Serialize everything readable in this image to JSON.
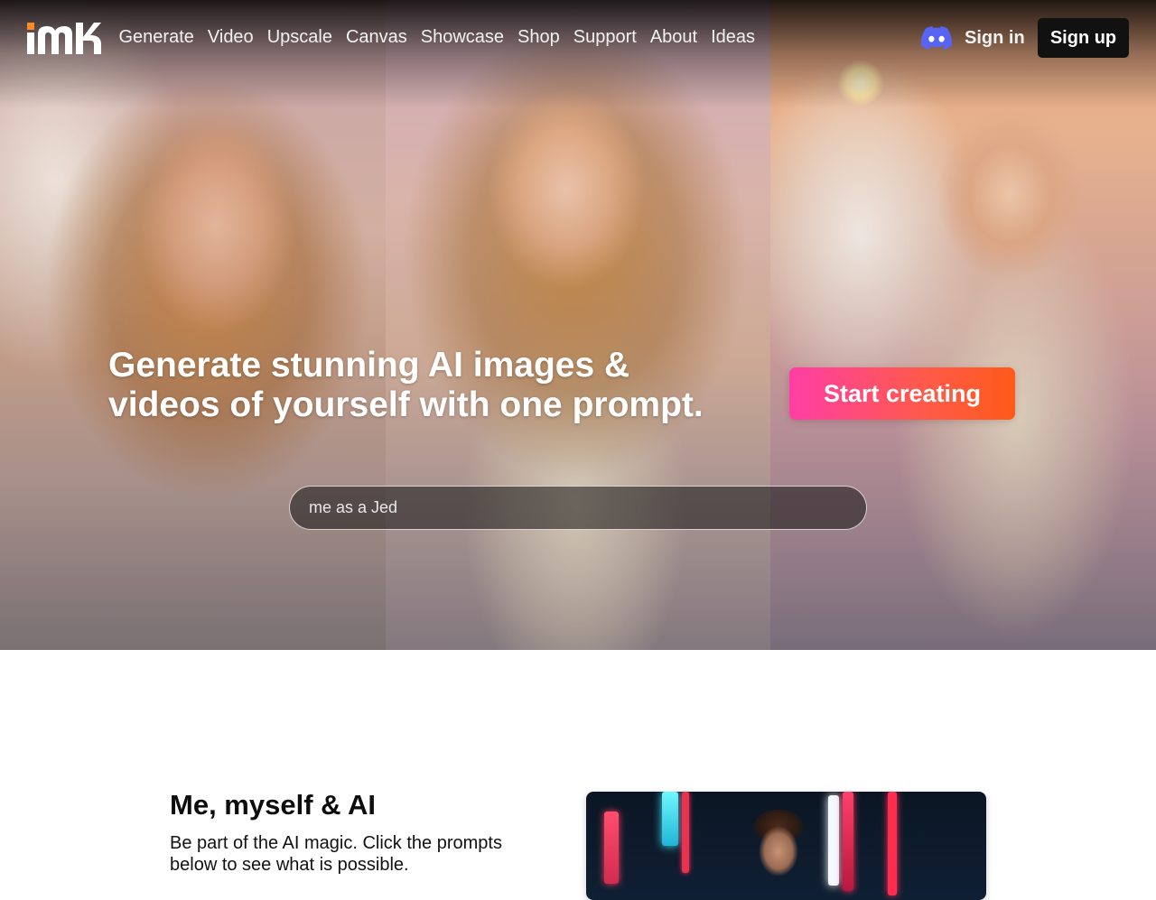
{
  "nav": {
    "logo_alt": "me",
    "links": [
      "Generate",
      "Video",
      "Upscale",
      "Canvas",
      "Showcase",
      "Shop",
      "Support",
      "About",
      "Ideas"
    ],
    "sign_in": "Sign in",
    "sign_up": "Sign up",
    "discord_icon": "discord-icon"
  },
  "hero": {
    "headline": "Generate stunning AI images & videos of yourself with one prompt.",
    "cta": "Start creating",
    "prompt_value": "me as a Jed"
  },
  "section": {
    "title": "Me, myself & AI",
    "subtitle": "Be part of the AI magic. Click the prompts below to see what is possible."
  },
  "colors": {
    "cta_gradient_start": "#ff3ea5",
    "cta_gradient_end": "#ff5a1a",
    "logo_orange": "#ff8a1f",
    "discord": "#5865f2",
    "signup_bg": "#111111"
  }
}
